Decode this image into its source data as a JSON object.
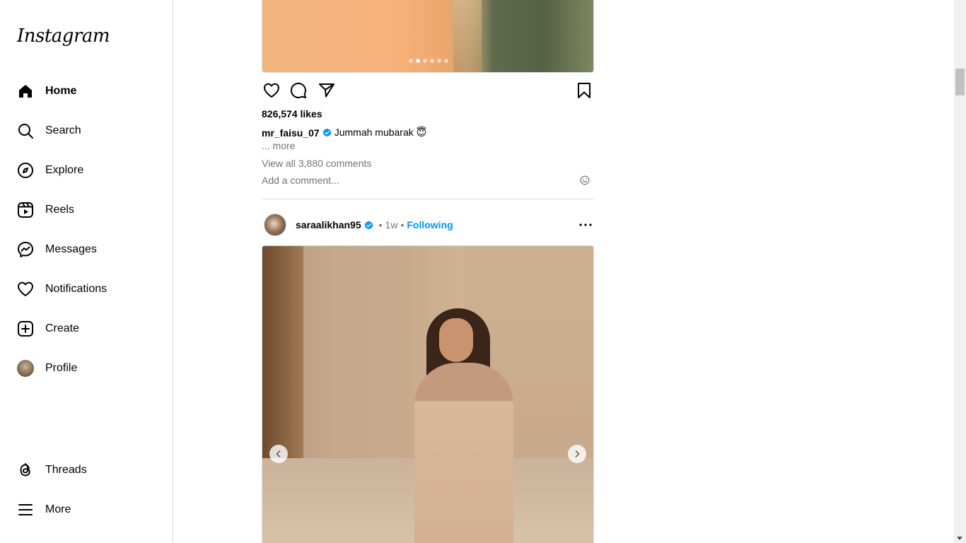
{
  "app": {
    "logo_text": "Instagram"
  },
  "sidebar": {
    "items": [
      {
        "label": "Home",
        "icon": "home-icon"
      },
      {
        "label": "Search",
        "icon": "search-icon"
      },
      {
        "label": "Explore",
        "icon": "compass-icon"
      },
      {
        "label": "Reels",
        "icon": "reels-icon"
      },
      {
        "label": "Messages",
        "icon": "messenger-icon"
      },
      {
        "label": "Notifications",
        "icon": "heart-icon"
      },
      {
        "label": "Create",
        "icon": "plus-square-icon"
      },
      {
        "label": "Profile",
        "icon": "avatar"
      }
    ],
    "bottom_items": [
      {
        "label": "Threads",
        "icon": "threads-icon"
      },
      {
        "label": "More",
        "icon": "hamburger-icon"
      }
    ]
  },
  "post1": {
    "likes": "826,574 likes",
    "username": "mr_faisu_07",
    "caption": "Jummah mubarak 😇",
    "more": "... more",
    "view_comments": "View all 3,880 comments",
    "comment_placeholder": "Add a comment..."
  },
  "post2": {
    "username": "saraalikhan95",
    "separator": "•",
    "time": "1w",
    "following": "Following"
  },
  "colors": {
    "link_blue": "#0095f6",
    "verified_blue": "#0095f6",
    "muted_text": "#737373",
    "border": "#dbdbdb"
  }
}
